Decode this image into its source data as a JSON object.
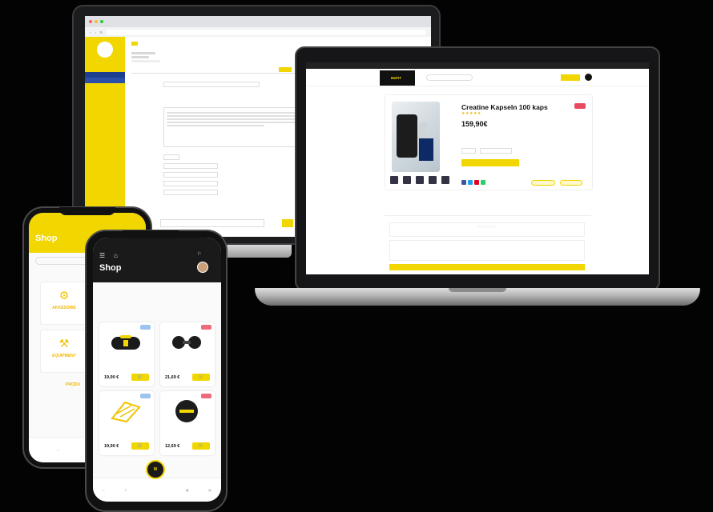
{
  "monitor": {
    "sidebar_items": [
      "",
      "",
      "",
      "",
      "",
      ""
    ],
    "address": ""
  },
  "laptop": {
    "product_title": "Creatine Kapseln 100 kaps",
    "product_price": "159,90€",
    "stars": "★★★★★",
    "sale_badge": "",
    "logo_text": "MeFIT"
  },
  "phone_back": {
    "title": "Shop",
    "categories": [
      "AKKESORIE",
      "EQUIPMENT"
    ],
    "products_label": "PRODU"
  },
  "phone_front": {
    "title": "Shop",
    "products": [
      {
        "price": "19,90 €",
        "badge_color": "#9cc4ee"
      },
      {
        "price": "21,69 €",
        "badge_color": "#ee6b7b"
      },
      {
        "price": "19,90 €",
        "badge_color": "#9cc4ee"
      },
      {
        "price": "12,69 €",
        "badge_color": "#ee6b7b"
      }
    ]
  },
  "colors": {
    "accent": "#f2d600",
    "background": "#030303"
  }
}
